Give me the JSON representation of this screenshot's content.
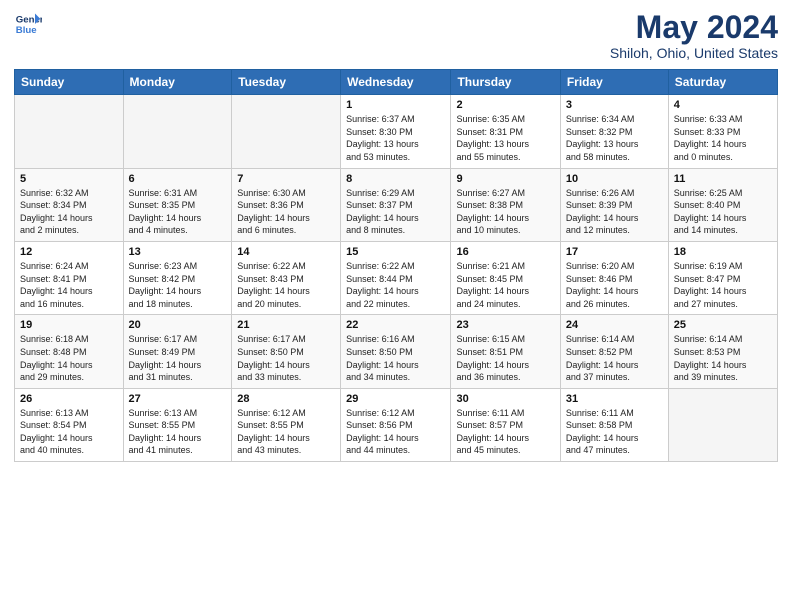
{
  "header": {
    "logo_line1": "General",
    "logo_line2": "Blue",
    "month": "May 2024",
    "location": "Shiloh, Ohio, United States"
  },
  "days_of_week": [
    "Sunday",
    "Monday",
    "Tuesday",
    "Wednesday",
    "Thursday",
    "Friday",
    "Saturday"
  ],
  "weeks": [
    {
      "row_class": "row-light",
      "days": [
        {
          "num": "",
          "info": ""
        },
        {
          "num": "",
          "info": ""
        },
        {
          "num": "",
          "info": ""
        },
        {
          "num": "1",
          "info": "Sunrise: 6:37 AM\nSunset: 8:30 PM\nDaylight: 13 hours\nand 53 minutes."
        },
        {
          "num": "2",
          "info": "Sunrise: 6:35 AM\nSunset: 8:31 PM\nDaylight: 13 hours\nand 55 minutes."
        },
        {
          "num": "3",
          "info": "Sunrise: 6:34 AM\nSunset: 8:32 PM\nDaylight: 13 hours\nand 58 minutes."
        },
        {
          "num": "4",
          "info": "Sunrise: 6:33 AM\nSunset: 8:33 PM\nDaylight: 14 hours\nand 0 minutes."
        }
      ]
    },
    {
      "row_class": "row-dark",
      "days": [
        {
          "num": "5",
          "info": "Sunrise: 6:32 AM\nSunset: 8:34 PM\nDaylight: 14 hours\nand 2 minutes."
        },
        {
          "num": "6",
          "info": "Sunrise: 6:31 AM\nSunset: 8:35 PM\nDaylight: 14 hours\nand 4 minutes."
        },
        {
          "num": "7",
          "info": "Sunrise: 6:30 AM\nSunset: 8:36 PM\nDaylight: 14 hours\nand 6 minutes."
        },
        {
          "num": "8",
          "info": "Sunrise: 6:29 AM\nSunset: 8:37 PM\nDaylight: 14 hours\nand 8 minutes."
        },
        {
          "num": "9",
          "info": "Sunrise: 6:27 AM\nSunset: 8:38 PM\nDaylight: 14 hours\nand 10 minutes."
        },
        {
          "num": "10",
          "info": "Sunrise: 6:26 AM\nSunset: 8:39 PM\nDaylight: 14 hours\nand 12 minutes."
        },
        {
          "num": "11",
          "info": "Sunrise: 6:25 AM\nSunset: 8:40 PM\nDaylight: 14 hours\nand 14 minutes."
        }
      ]
    },
    {
      "row_class": "row-light",
      "days": [
        {
          "num": "12",
          "info": "Sunrise: 6:24 AM\nSunset: 8:41 PM\nDaylight: 14 hours\nand 16 minutes."
        },
        {
          "num": "13",
          "info": "Sunrise: 6:23 AM\nSunset: 8:42 PM\nDaylight: 14 hours\nand 18 minutes."
        },
        {
          "num": "14",
          "info": "Sunrise: 6:22 AM\nSunset: 8:43 PM\nDaylight: 14 hours\nand 20 minutes."
        },
        {
          "num": "15",
          "info": "Sunrise: 6:22 AM\nSunset: 8:44 PM\nDaylight: 14 hours\nand 22 minutes."
        },
        {
          "num": "16",
          "info": "Sunrise: 6:21 AM\nSunset: 8:45 PM\nDaylight: 14 hours\nand 24 minutes."
        },
        {
          "num": "17",
          "info": "Sunrise: 6:20 AM\nSunset: 8:46 PM\nDaylight: 14 hours\nand 26 minutes."
        },
        {
          "num": "18",
          "info": "Sunrise: 6:19 AM\nSunset: 8:47 PM\nDaylight: 14 hours\nand 27 minutes."
        }
      ]
    },
    {
      "row_class": "row-dark",
      "days": [
        {
          "num": "19",
          "info": "Sunrise: 6:18 AM\nSunset: 8:48 PM\nDaylight: 14 hours\nand 29 minutes."
        },
        {
          "num": "20",
          "info": "Sunrise: 6:17 AM\nSunset: 8:49 PM\nDaylight: 14 hours\nand 31 minutes."
        },
        {
          "num": "21",
          "info": "Sunrise: 6:17 AM\nSunset: 8:50 PM\nDaylight: 14 hours\nand 33 minutes."
        },
        {
          "num": "22",
          "info": "Sunrise: 6:16 AM\nSunset: 8:50 PM\nDaylight: 14 hours\nand 34 minutes."
        },
        {
          "num": "23",
          "info": "Sunrise: 6:15 AM\nSunset: 8:51 PM\nDaylight: 14 hours\nand 36 minutes."
        },
        {
          "num": "24",
          "info": "Sunrise: 6:14 AM\nSunset: 8:52 PM\nDaylight: 14 hours\nand 37 minutes."
        },
        {
          "num": "25",
          "info": "Sunrise: 6:14 AM\nSunset: 8:53 PM\nDaylight: 14 hours\nand 39 minutes."
        }
      ]
    },
    {
      "row_class": "row-light",
      "days": [
        {
          "num": "26",
          "info": "Sunrise: 6:13 AM\nSunset: 8:54 PM\nDaylight: 14 hours\nand 40 minutes."
        },
        {
          "num": "27",
          "info": "Sunrise: 6:13 AM\nSunset: 8:55 PM\nDaylight: 14 hours\nand 41 minutes."
        },
        {
          "num": "28",
          "info": "Sunrise: 6:12 AM\nSunset: 8:55 PM\nDaylight: 14 hours\nand 43 minutes."
        },
        {
          "num": "29",
          "info": "Sunrise: 6:12 AM\nSunset: 8:56 PM\nDaylight: 14 hours\nand 44 minutes."
        },
        {
          "num": "30",
          "info": "Sunrise: 6:11 AM\nSunset: 8:57 PM\nDaylight: 14 hours\nand 45 minutes."
        },
        {
          "num": "31",
          "info": "Sunrise: 6:11 AM\nSunset: 8:58 PM\nDaylight: 14 hours\nand 47 minutes."
        },
        {
          "num": "",
          "info": ""
        }
      ]
    }
  ]
}
